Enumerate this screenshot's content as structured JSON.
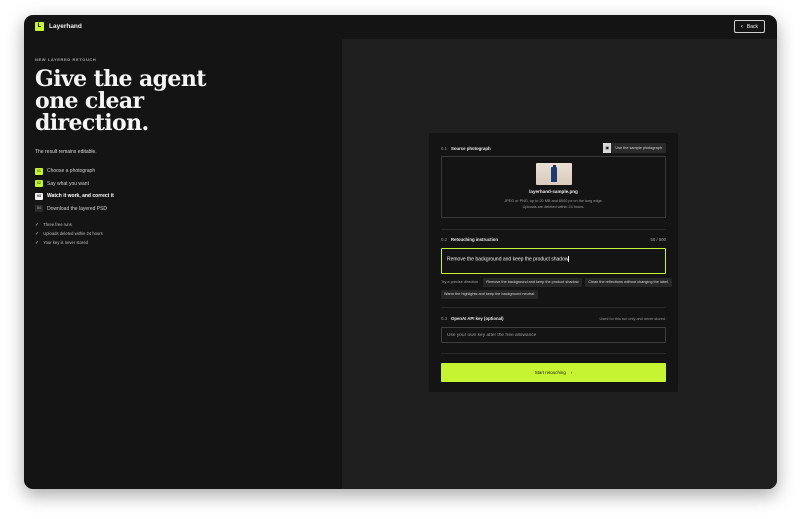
{
  "app": {
    "name": "Layerhand",
    "logo_letter": "L",
    "back_label": "Back"
  },
  "intro": {
    "kicker": "NEW LAYERED RETOUCH",
    "headline": "Give the agent one clear direction.",
    "subtext": "The result remains editable."
  },
  "steps": [
    {
      "num": "01",
      "label": "Choose a photograph",
      "state": "done"
    },
    {
      "num": "02",
      "label": "Say what you want",
      "state": "done"
    },
    {
      "num": "03",
      "label": "Watch it work, and correct it",
      "state": "active"
    },
    {
      "num": "04",
      "label": "Download the layered PSD",
      "state": "pending"
    }
  ],
  "facts": [
    "Three free runs",
    "Uploads deleted within 24 hours",
    "Your key is never stored"
  ],
  "source": {
    "index": "0.1",
    "title": "Source photograph",
    "sample_button": "Use the sample photograph",
    "file_name": "layerhand-sample.png",
    "hint_line1": "JPEG or PNG, up to 20 MB and 8000 px on the long edge.",
    "hint_line2": "Uploads are deleted within 24 hours."
  },
  "instruction": {
    "index": "0.2",
    "title": "Retouching instruction",
    "counter": "50 / 500",
    "value": "Remove the background and keep the product shadow",
    "try_label": "Try a precise direction",
    "suggestions": [
      "Remove the background and keep the product shadow.",
      "Clean the reflections without changing the label.",
      "Warm the highlights and keep the background neutral."
    ]
  },
  "api": {
    "index": "0.3",
    "title": "OpenAI API key (optional)",
    "note": "Used for this run only and never stored.",
    "placeholder": "Use your own key after the free allowance"
  },
  "actions": {
    "start_label": "Start retouching",
    "start_arrow": "›"
  },
  "colors": {
    "accent": "#c6f432",
    "background": "#141414",
    "panel": "#1f1f1f"
  }
}
